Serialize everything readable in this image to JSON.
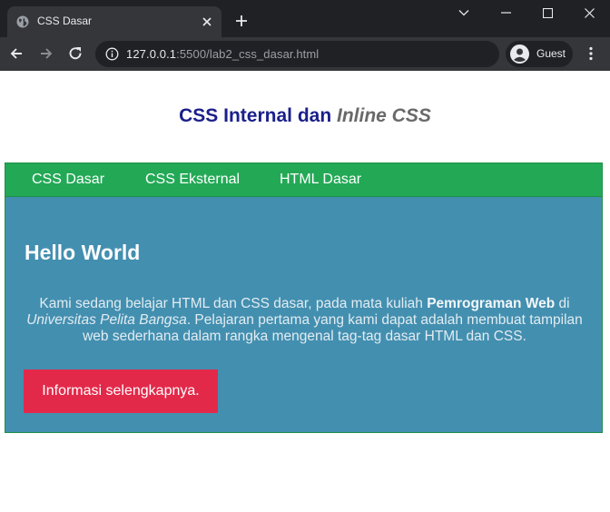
{
  "browser": {
    "tab_title": "CSS Dasar",
    "url_host": "127.0.0.1",
    "url_rest": ":5500/lab2_css_dasar.html",
    "profile_label": "Guest",
    "icons": [
      "globe-icon",
      "close-icon",
      "plus-icon",
      "chevron-down-icon",
      "minimize-icon",
      "maximize-icon",
      "close-window-icon",
      "back-arrow-icon",
      "forward-arrow-icon",
      "reload-icon",
      "info-icon",
      "avatar-icon",
      "more-vert-icon"
    ]
  },
  "page": {
    "title_part1": "CSS Internal dan ",
    "title_italic": "Inline",
    "title_part2": " CSS",
    "nav": [
      "CSS Dasar",
      "CSS Eksternal",
      "HTML Dasar"
    ],
    "heading": "Hello World",
    "paragraph": {
      "t1": "Kami sedang belajar HTML dan CSS dasar, pada mata kuliah ",
      "bold": "Pemrograman Web",
      "t2": " di ",
      "italic": "Universitas Pelita Bangsa",
      "t3": ". Pelajaran pertama yang kami dapat adalah membuat tampilan web sederhana dalam rangka mengenal tag-tag dasar HTML dan CSS."
    },
    "button_label": "Informasi selengkapnya."
  },
  "colors": {
    "title_blue": "#1a1f8a",
    "navbar_green": "#23a956",
    "content_blue": "#438fb0",
    "button_red": "#e3294a"
  }
}
